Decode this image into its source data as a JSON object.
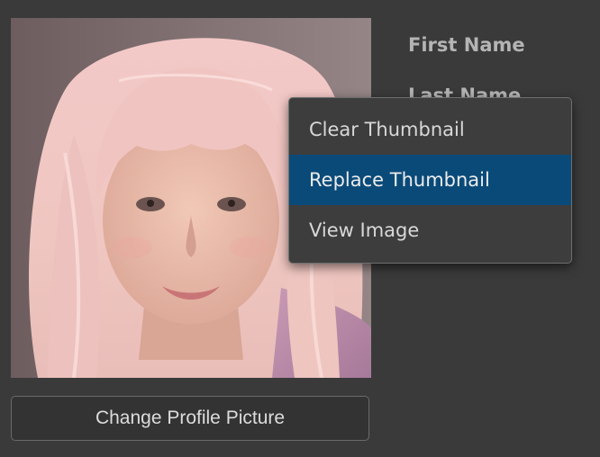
{
  "profile": {
    "thumbnail_alt": "profile photo",
    "change_button_label": "Change Profile Picture"
  },
  "fields": {
    "first_name_label": "First Name",
    "last_name_label": "Last Name"
  },
  "context_menu": {
    "items": [
      {
        "label": "Clear Thumbnail",
        "highlighted": false
      },
      {
        "label": "Replace Thumbnail",
        "highlighted": true
      },
      {
        "label": "View Image",
        "highlighted": false
      }
    ]
  },
  "colors": {
    "background": "#3a3a3a",
    "menu_highlight": "#0a4a79",
    "label_text": "#b4b4b4"
  }
}
